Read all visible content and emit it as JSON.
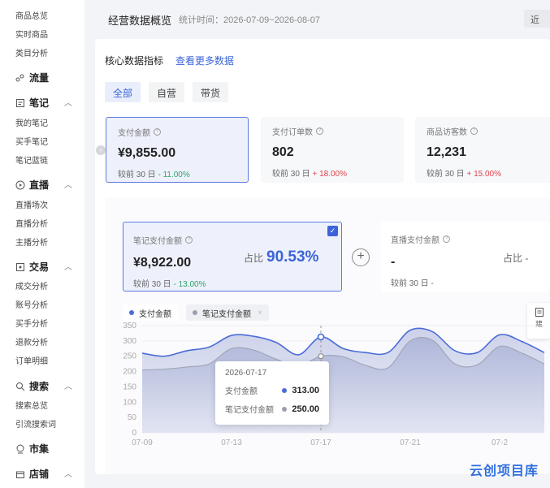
{
  "sidebar": {
    "sub_top": [
      "商品总览",
      "实时商品",
      "类目分析"
    ],
    "groups": [
      {
        "title": "流量",
        "icon": "traffic-icon",
        "items": []
      },
      {
        "title": "笔记",
        "icon": "note-icon",
        "items": [
          "我的笔记",
          "买手笔记",
          "笔记蓝链"
        ]
      },
      {
        "title": "直播",
        "icon": "live-icon",
        "items": [
          "直播场次",
          "直播分析",
          "主播分析"
        ]
      },
      {
        "title": "交易",
        "icon": "trade-icon",
        "items": [
          "成交分析",
          "账号分析",
          "买手分析",
          "退款分析",
          "订单明细"
        ]
      },
      {
        "title": "搜索",
        "icon": "search-icon",
        "items": [
          "搜索总览",
          "引流搜索词"
        ]
      },
      {
        "title": "市集",
        "icon": "market-icon",
        "items": []
      },
      {
        "title": "店铺",
        "icon": "shop-icon",
        "items": []
      }
    ]
  },
  "header": {
    "title": "经营数据概览",
    "stat_time": "统计时间：2026-07-09~2026-08-07",
    "recent_btn": "近"
  },
  "core": {
    "title": "核心数据指标",
    "more_link": "查看更多数据",
    "tabs": [
      "全部",
      "自营",
      "带货"
    ],
    "metrics": [
      {
        "label": "支付金额",
        "value": "¥9,855.00",
        "cmp_prefix": "较前 30 日",
        "cmp_value": "- 11.00%",
        "trend": "down"
      },
      {
        "label": "支付订单数",
        "value": "802",
        "cmp_prefix": "较前 30 日",
        "cmp_value": "+ 18.00%",
        "trend": "up"
      },
      {
        "label": "商品访客数",
        "value": "12,231",
        "cmp_prefix": "较前 30 日",
        "cmp_value": "+ 15.00%",
        "trend": "up"
      }
    ]
  },
  "note_box": {
    "label": "笔记支付金额",
    "value": "¥8,922.00",
    "share_label": "占比",
    "share_value": "90.53%",
    "cmp_prefix": "较前 30 日",
    "cmp_value": "- 13.00%"
  },
  "live_box": {
    "label": "直播支付金额",
    "value": "-",
    "share_label": "占比",
    "share_value": "-",
    "cmp_prefix": "较前 30 日",
    "cmp_value": "-"
  },
  "colors": {
    "accent": "#3c64d8",
    "series1": "#4a6cd6",
    "series2": "#9aa0b0",
    "green": "#2ba56a",
    "red": "#e0444e"
  },
  "tooltip": {
    "date": "2026-07-17",
    "rows": [
      {
        "label": "支付金额",
        "value": "313.00"
      },
      {
        "label": "笔记支付金额",
        "value": "250.00"
      }
    ]
  },
  "corner_tool": "建",
  "watermark": "云创项目库",
  "chart_data": {
    "type": "area",
    "x": [
      "07-09",
      "07-10",
      "07-11",
      "07-12",
      "07-13",
      "07-14",
      "07-15",
      "07-16",
      "07-17",
      "07-18",
      "07-19",
      "07-20",
      "07-21",
      "07-22",
      "07-23",
      "07-24",
      "07-25",
      "07-26",
      "07-27"
    ],
    "x_tick_labels": [
      "07-09",
      "07-13",
      "07-17",
      "07-21",
      "07-2"
    ],
    "series": [
      {
        "name": "支付金额",
        "values": [
          260,
          250,
          268,
          280,
          318,
          315,
          295,
          255,
          313,
          275,
          262,
          262,
          335,
          330,
          268,
          262,
          320,
          298,
          262
        ]
      },
      {
        "name": "笔记支付金额",
        "values": [
          205,
          208,
          215,
          225,
          275,
          270,
          240,
          218,
          250,
          248,
          220,
          212,
          300,
          302,
          225,
          222,
          282,
          260,
          225
        ]
      }
    ],
    "yticks": [
      0,
      50,
      100,
      150,
      200,
      250,
      300,
      350
    ],
    "ylim": [
      0,
      350
    ],
    "grid": true,
    "legend": "top-left"
  }
}
